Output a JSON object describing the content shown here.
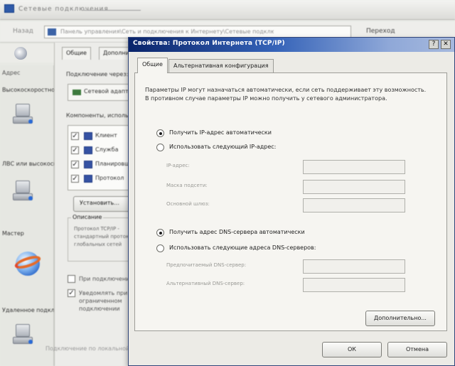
{
  "background_window": {
    "title": "Сетевые подключения",
    "address_path": "Панель управления\\Сеть и подключения к Интернету\\Сетевые подключения",
    "back_label": "Назад",
    "go_buttons": "Переход",
    "address_label": "Адрес",
    "nav_labels": [
      "Высокоскоростной",
      "ЛВС или высокоскоростной Интернет",
      "Мастер",
      "Удаленное подключение"
    ],
    "status_text": "Подключение по локальной сети"
  },
  "connection_panel": {
    "tabs": [
      "Общие",
      "Дополнительно"
    ],
    "connect_using_label": "Подключение через:",
    "adapter_name": "Сетевой адаптер",
    "components_label": "Компоненты, используемые этим подключением:",
    "components": [
      {
        "label": "Клиент",
        "checked": true
      },
      {
        "label": "Служба",
        "checked": true
      },
      {
        "label": "Планировщик",
        "checked": true
      },
      {
        "label": "Протокол",
        "checked": true
      }
    ],
    "install_button": "Установить...",
    "description_title": "Описание",
    "description_text": "Протокол TCP/IP - стандартный протокол глобальных сетей",
    "show_icon_label": "При подключении вывести значок",
    "notify_label": "Уведомлять при ограниченном подключении"
  },
  "dialog": {
    "title": "Свойства: Протокол Интернета (TCP/IP)",
    "help_glyph": "?",
    "close_glyph": "✕",
    "tabs": [
      "Общие",
      "Альтернативная конфигурация"
    ],
    "description": "Параметры IP могут назначаться автоматически, если сеть поддерживает эту возможность. В противном случае параметры IP можно получить у сетевого администратора.",
    "ip_auto_label": "Получить IP-адрес автоматически",
    "ip_manual_label": "Использовать следующий IP-адрес:",
    "ip_fields": [
      "IP-адрес:",
      "Маска подсети:",
      "Основной шлюз:"
    ],
    "dns_auto_label": "Получить адрес DNS-сервера автоматически",
    "dns_manual_label": "Использовать следующие адреса DNS-серверов:",
    "dns_fields": [
      "Предпочитаемый DNS-сервер:",
      "Альтернативный DNS-сервер:"
    ],
    "advanced_button": "Дополнительно...",
    "ok_button": "ОК",
    "cancel_button": "Отмена",
    "ip_auto_selected": true,
    "dns_auto_selected": true
  },
  "colors": {
    "titlebar_start": "#0a246a",
    "titlebar_end": "#a6b9de",
    "dialog_bg": "#ecebe6",
    "page_bg": "#f6f5f1"
  }
}
